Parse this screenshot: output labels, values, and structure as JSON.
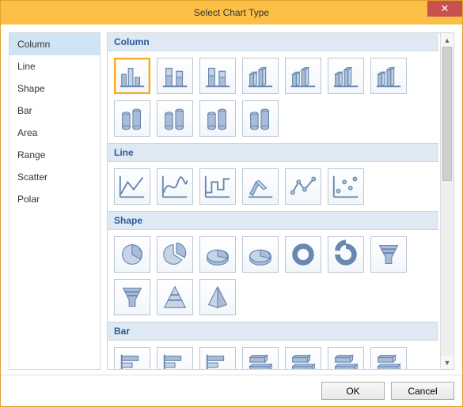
{
  "window": {
    "title": "Select Chart Type"
  },
  "sidebar": {
    "items": [
      {
        "label": "Column",
        "selected": true
      },
      {
        "label": "Line",
        "selected": false
      },
      {
        "label": "Shape",
        "selected": false
      },
      {
        "label": "Bar",
        "selected": false
      },
      {
        "label": "Area",
        "selected": false
      },
      {
        "label": "Range",
        "selected": false
      },
      {
        "label": "Scatter",
        "selected": false
      },
      {
        "label": "Polar",
        "selected": false
      }
    ]
  },
  "sections": [
    {
      "title": "Column",
      "charts": [
        {
          "name": "clustered-column",
          "selected": true
        },
        {
          "name": "stacked-column",
          "selected": false
        },
        {
          "name": "100-stacked-column",
          "selected": false
        },
        {
          "name": "3d-clustered-column",
          "selected": false
        },
        {
          "name": "3d-stacked-column",
          "selected": false
        },
        {
          "name": "3d-100-stacked-column",
          "selected": false
        },
        {
          "name": "3d-column",
          "selected": false
        },
        {
          "name": "clustered-cylinder",
          "selected": false
        },
        {
          "name": "stacked-cylinder",
          "selected": false
        },
        {
          "name": "100-stacked-cylinder",
          "selected": false
        },
        {
          "name": "3d-cylinder",
          "selected": false
        }
      ]
    },
    {
      "title": "Line",
      "charts": [
        {
          "name": "line",
          "selected": false
        },
        {
          "name": "spline",
          "selected": false
        },
        {
          "name": "step-line",
          "selected": false
        },
        {
          "name": "3d-line",
          "selected": false
        },
        {
          "name": "line-with-markers",
          "selected": false
        },
        {
          "name": "scatter-line",
          "selected": false
        }
      ]
    },
    {
      "title": "Shape",
      "charts": [
        {
          "name": "pie",
          "selected": false
        },
        {
          "name": "exploded-pie",
          "selected": false
        },
        {
          "name": "3d-pie",
          "selected": false
        },
        {
          "name": "3d-exploded-pie",
          "selected": false
        },
        {
          "name": "doughnut",
          "selected": false
        },
        {
          "name": "exploded-doughnut",
          "selected": false
        },
        {
          "name": "funnel",
          "selected": false
        },
        {
          "name": "funnel-3d",
          "selected": false
        },
        {
          "name": "pyramid",
          "selected": false
        },
        {
          "name": "pyramid-3d",
          "selected": false
        }
      ]
    },
    {
      "title": "Bar",
      "charts": [
        {
          "name": "clustered-bar",
          "selected": false
        },
        {
          "name": "stacked-bar",
          "selected": false
        },
        {
          "name": "100-stacked-bar",
          "selected": false
        },
        {
          "name": "3d-clustered-bar",
          "selected": false
        },
        {
          "name": "3d-stacked-bar",
          "selected": false
        },
        {
          "name": "3d-100-stacked-bar",
          "selected": false
        },
        {
          "name": "3d-bar",
          "selected": false
        }
      ]
    }
  ],
  "buttons": {
    "ok": "OK",
    "cancel": "Cancel"
  }
}
